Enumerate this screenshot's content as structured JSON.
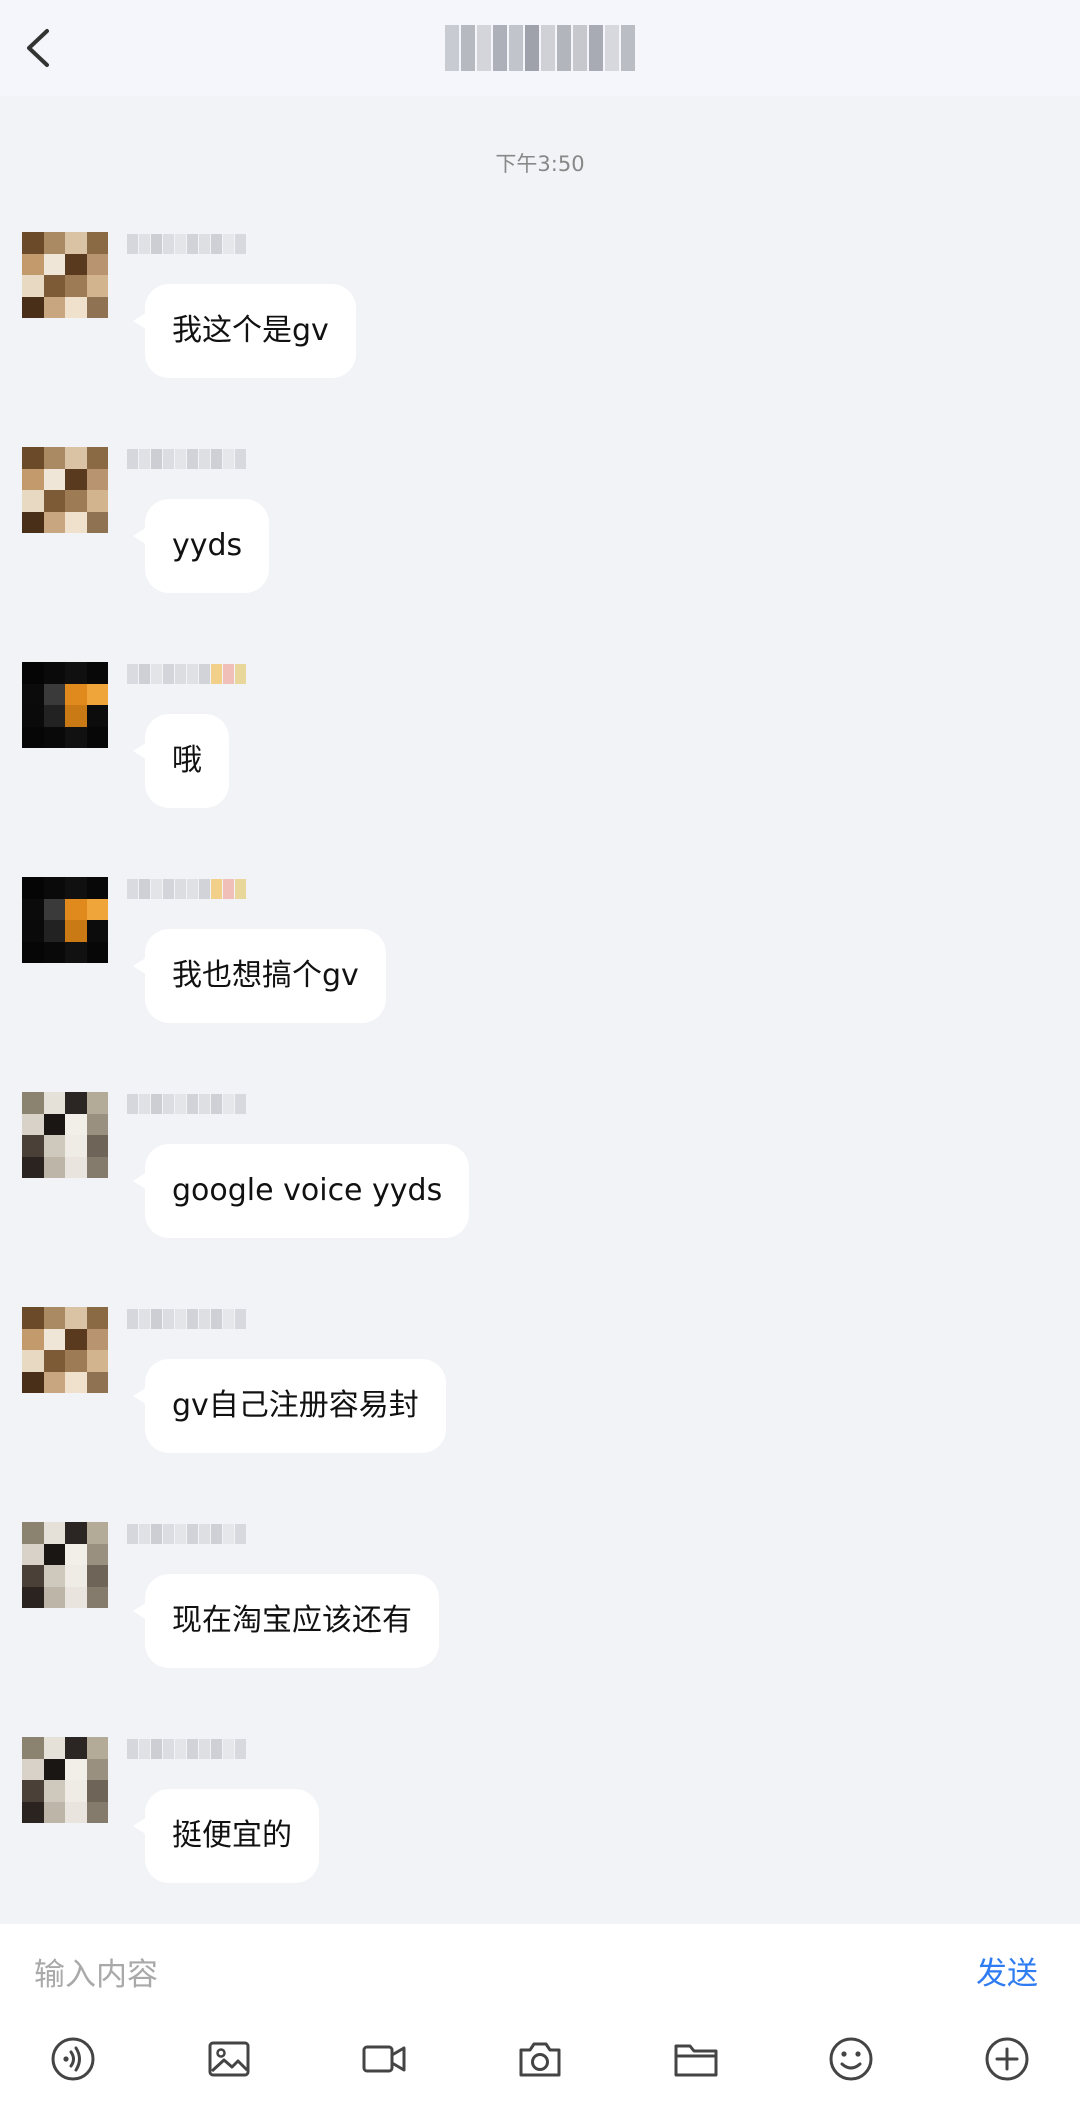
{
  "header": {
    "title": ""
  },
  "timestamp": "下午3:50",
  "messages": [
    {
      "text": "我这个是gv",
      "avatar": "avatar-a"
    },
    {
      "text": "yyds",
      "avatar": "avatar-a"
    },
    {
      "text": "哦",
      "avatar": "avatar-b"
    },
    {
      "text": "我也想搞个gv",
      "avatar": "avatar-b"
    },
    {
      "text": "google voice yyds",
      "avatar": "avatar-c"
    },
    {
      "text": "gv自己注册容易封",
      "avatar": "avatar-a"
    },
    {
      "text": "现在淘宝应该还有",
      "avatar": "avatar-c"
    },
    {
      "text": "挺便宜的",
      "avatar": "avatar-c"
    }
  ],
  "composer": {
    "placeholder": "输入内容",
    "send_label": "发送"
  },
  "toolbar": {
    "items": [
      "voice-icon",
      "image-icon",
      "video-icon",
      "camera-icon",
      "folder-icon",
      "emoji-icon",
      "plus-circle-icon"
    ]
  },
  "colors": {
    "background": "#f2f3f7",
    "header": "#f5f6fb",
    "bubble": "#ffffff",
    "send": "#2e7bf2"
  }
}
